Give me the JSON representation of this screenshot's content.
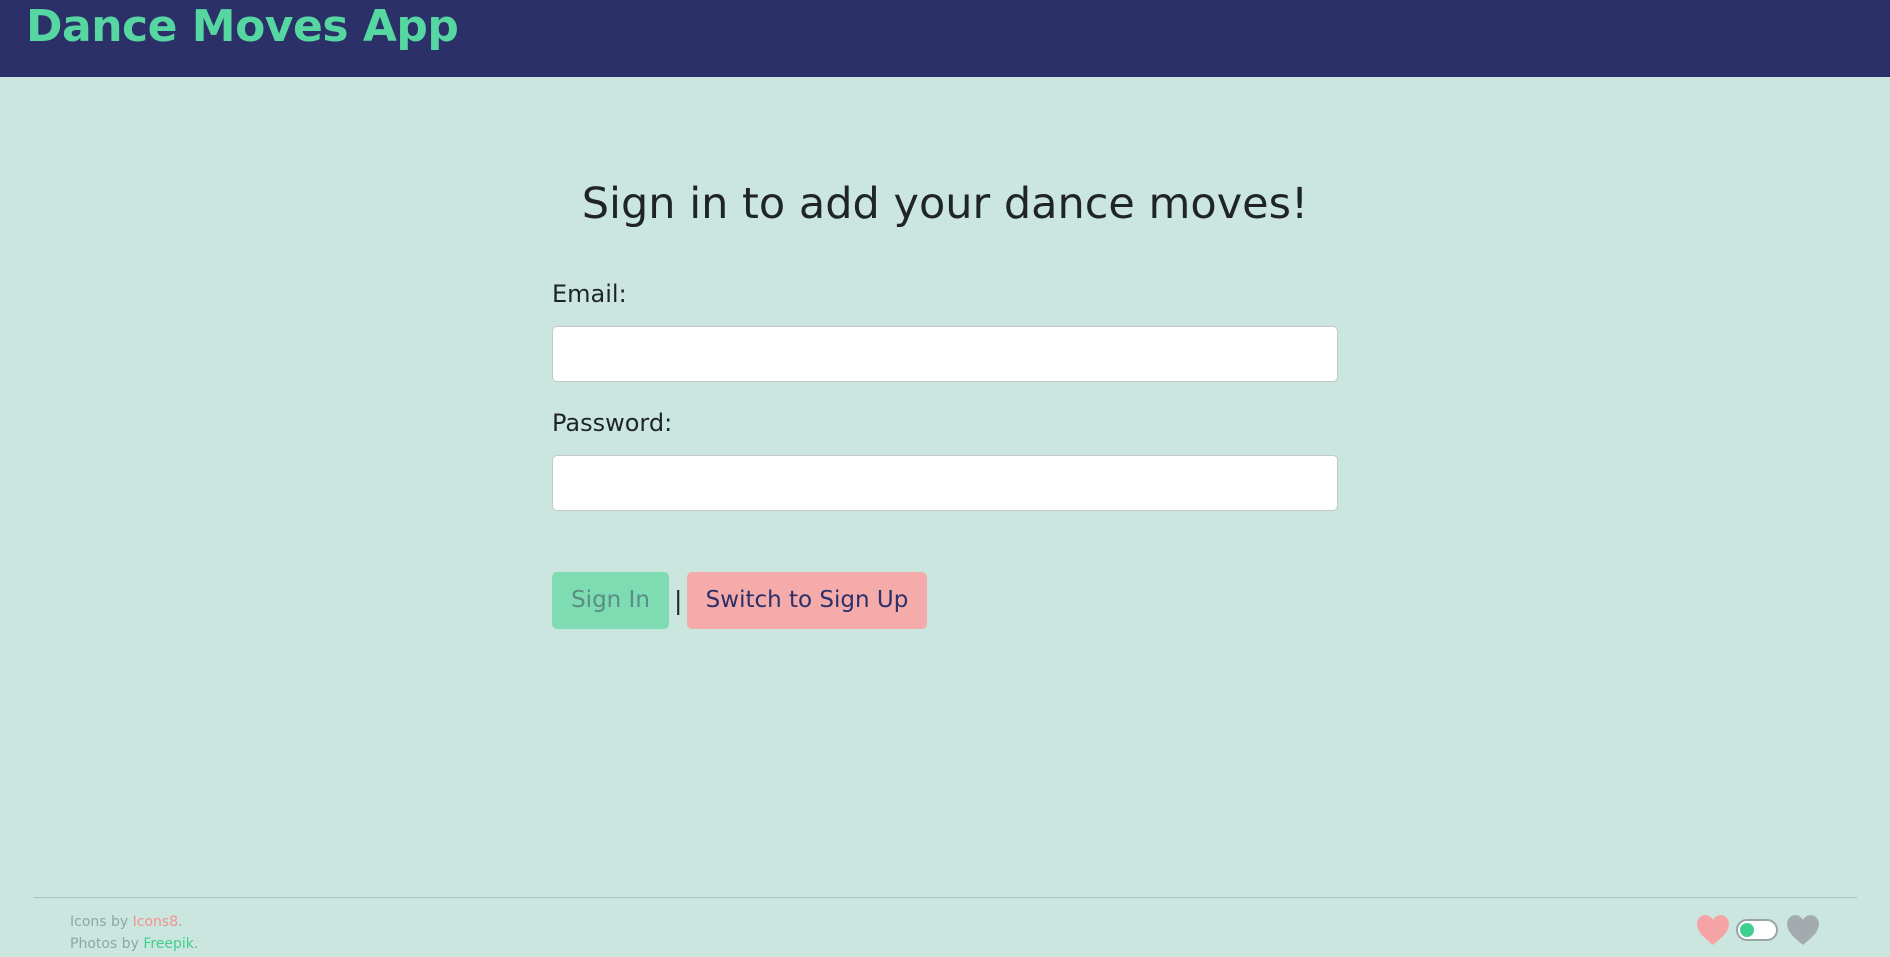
{
  "header": {
    "app_title": "Dance Moves App"
  },
  "main": {
    "title": "Sign in to add your dance moves!",
    "email": {
      "label": "Email:",
      "value": "",
      "placeholder": ""
    },
    "password": {
      "label": "Password:",
      "value": "",
      "placeholder": ""
    },
    "sign_in_label": "Sign In",
    "separator": "|",
    "switch_label": "Switch to Sign Up"
  },
  "footer": {
    "icons_prefix": "Icons by ",
    "icons_link": "Icons8",
    "icons_suffix": ".",
    "photos_prefix": "Photos by ",
    "photos_link": "Freepik",
    "photos_suffix": ".",
    "theme_toggle": {
      "left_icon": "heart-icon",
      "right_icon": "heart-icon",
      "state": "on"
    }
  },
  "colors": {
    "header_bg": "#2b3068",
    "brand": "#56d6a0",
    "page_bg": "#cbe6df",
    "sign_in_button": "#7ddcb1",
    "switch_button": "#f4abaa",
    "icons8_link": "#f2918f",
    "freepik_link": "#3fcf8e"
  }
}
